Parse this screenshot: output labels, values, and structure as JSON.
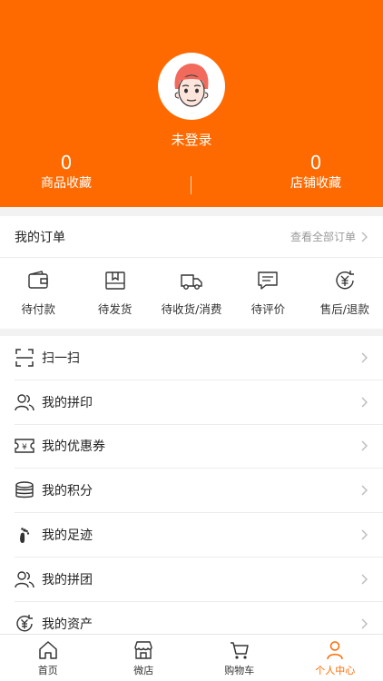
{
  "profile": {
    "username": "未登录",
    "favorites_goods": {
      "count": "0",
      "label": "商品收藏"
    },
    "favorites_shops": {
      "count": "0",
      "label": "店铺收藏"
    }
  },
  "orders": {
    "title": "我的订单",
    "view_all": "查看全部订单",
    "items": [
      {
        "label": "待付款",
        "icon": "wallet-icon"
      },
      {
        "label": "待发货",
        "icon": "box-icon"
      },
      {
        "label": "待收货/消费",
        "icon": "truck-icon"
      },
      {
        "label": "待评价",
        "icon": "comment-icon"
      },
      {
        "label": "售后/退款",
        "icon": "refund-icon"
      }
    ]
  },
  "menu": {
    "items": [
      {
        "label": "扫一扫",
        "icon": "scan-icon"
      },
      {
        "label": "我的拼印",
        "icon": "users-icon"
      },
      {
        "label": "我的优惠券",
        "icon": "coupon-icon"
      },
      {
        "label": "我的积分",
        "icon": "coins-icon"
      },
      {
        "label": "我的足迹",
        "icon": "footprint-icon"
      },
      {
        "label": "我的拼团",
        "icon": "group-icon"
      },
      {
        "label": "我的资产",
        "icon": "asset-icon"
      }
    ]
  },
  "tabbar": {
    "items": [
      {
        "label": "首页",
        "icon": "home-icon"
      },
      {
        "label": "微店",
        "icon": "store-icon"
      },
      {
        "label": "购物车",
        "icon": "cart-icon"
      },
      {
        "label": "个人中心",
        "icon": "person-icon",
        "active": true
      }
    ]
  },
  "colors": {
    "accent": "#ff6a00",
    "text": "#333333",
    "muted": "#999999"
  }
}
